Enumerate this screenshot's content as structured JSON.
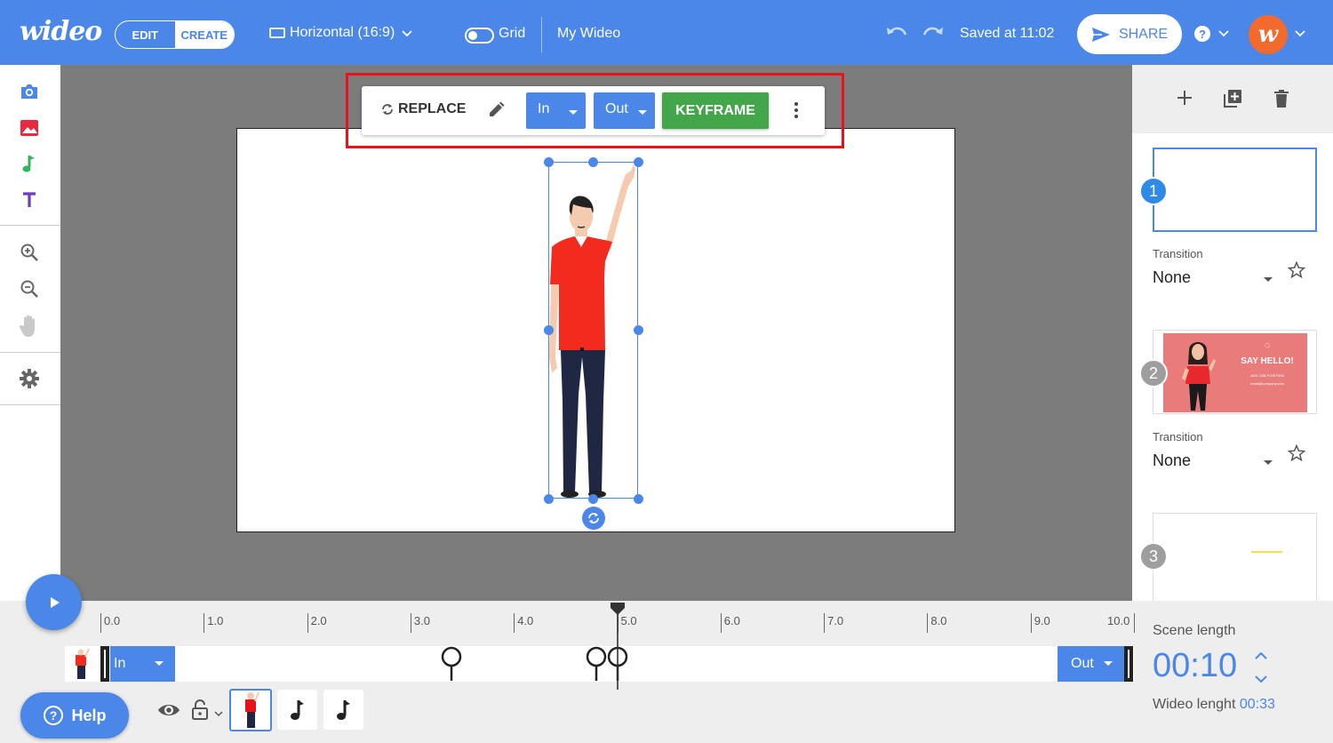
{
  "header": {
    "logo": "wideo",
    "mode_edit": "EDIT",
    "mode_create": "CREATE",
    "aspect_ratio": "Horizontal (16:9)",
    "grid_label": "Grid",
    "grid_enabled": false,
    "project_title": "My Wideo",
    "saved_status": "Saved at 11:02",
    "share_label": "SHARE",
    "avatar_letter": "w",
    "accent_color": "#4a87e8"
  },
  "left_tools": [
    "camera-icon",
    "image-icon",
    "music-note-icon",
    "text-tool-icon",
    "zoom-in-icon",
    "zoom-out-icon",
    "hand-pan-icon",
    "gear-icon"
  ],
  "object_toolbar": {
    "replace_label": "REPLACE",
    "in_label": "In",
    "out_label": "Out",
    "keyframe_label": "KEYFRAME"
  },
  "scenes": [
    {
      "number": "1",
      "transition_label": "Transition",
      "transition_value": "None"
    },
    {
      "number": "2",
      "transition_label": "Transition",
      "transition_value": "None",
      "thumb_title": "SAY HELLO!",
      "thumb_subtitle": "ADD JOB POSITION",
      "thumb_email": "email@company.com"
    },
    {
      "number": "3"
    }
  ],
  "timeline": {
    "ticks": [
      "0.0",
      "1.0",
      "2.0",
      "3.0",
      "4.0",
      "5.0",
      "6.0",
      "7.0",
      "8.0",
      "9.0",
      "10.0"
    ],
    "playhead_time": 5.0,
    "keyframe_times": [
      3.4,
      4.8,
      5.0
    ],
    "in_label": "In",
    "out_label": "Out"
  },
  "help_label": "Help",
  "scene_length": {
    "label": "Scene length",
    "value": "00:10",
    "wideo_length_label": "Wideo lenght",
    "wideo_length_value": "00:33"
  }
}
